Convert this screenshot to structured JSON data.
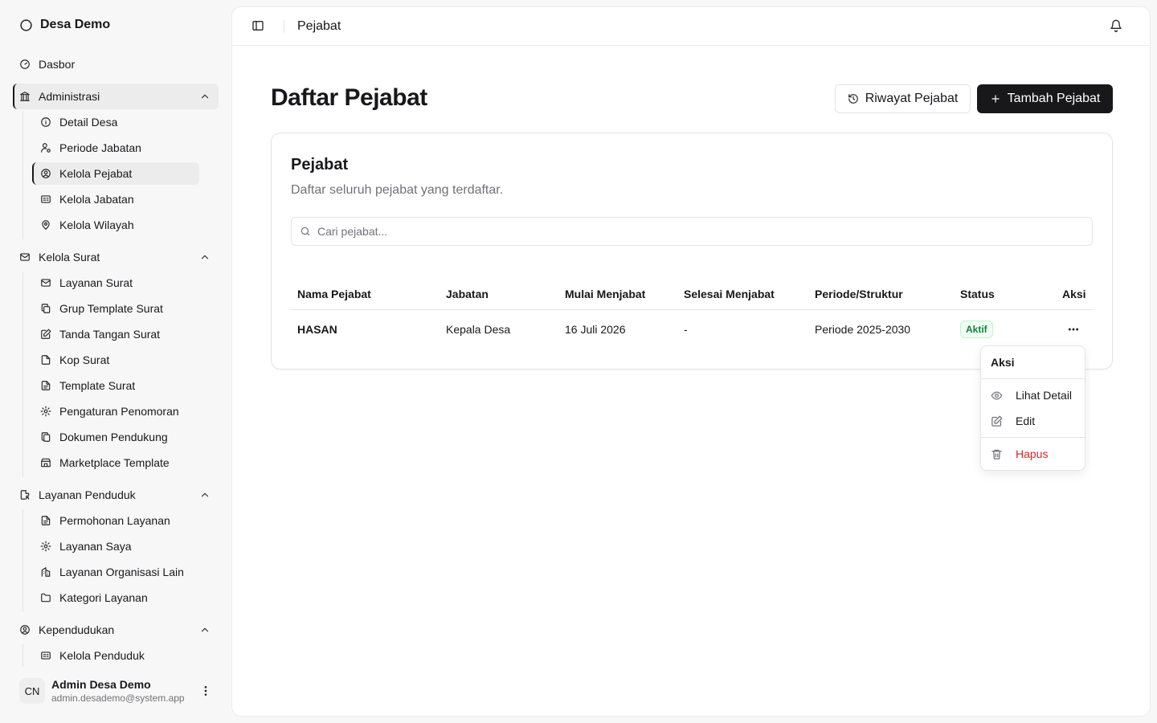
{
  "sidebar": {
    "brand": "Desa Demo",
    "dashboard": "Dasbor",
    "groups": [
      {
        "label": "Administrasi",
        "items": [
          "Detail Desa",
          "Periode Jabatan",
          "Kelola Pejabat",
          "Kelola Jabatan",
          "Kelola Wilayah"
        ]
      },
      {
        "label": "Kelola Surat",
        "items": [
          "Layanan Surat",
          "Grup Template Surat",
          "Tanda Tangan Surat",
          "Kop Surat",
          "Template Surat",
          "Pengaturan Penomoran",
          "Dokumen Pendukung",
          "Marketplace Template"
        ]
      },
      {
        "label": "Layanan Penduduk",
        "items": [
          "Permohonan Layanan",
          "Layanan Saya",
          "Layanan Organisasi Lain",
          "Kategori Layanan"
        ]
      },
      {
        "label": "Kependudukan",
        "items": [
          "Kelola Penduduk"
        ]
      }
    ],
    "user": {
      "initials": "CN",
      "name": "Admin Desa Demo",
      "email": "admin.desademo@system.app"
    }
  },
  "topbar": {
    "title": "Pejabat"
  },
  "page": {
    "title": "Daftar Pejabat",
    "history_button": "Riwayat Pejabat",
    "add_button": "Tambah Pejabat"
  },
  "card": {
    "title": "Pejabat",
    "description": "Daftar seluruh pejabat yang terdaftar.",
    "search_placeholder": "Cari pejabat..."
  },
  "table": {
    "headers": [
      "Nama Pejabat",
      "Jabatan",
      "Mulai Menjabat",
      "Selesai Menjabat",
      "Periode/Struktur",
      "Status",
      "Aksi"
    ],
    "rows": [
      {
        "nama": "HASAN",
        "jabatan": "Kepala Desa",
        "mulai": "16 Juli 2026",
        "selesai": "-",
        "periode": "Periode 2025-2030",
        "status": "Aktif"
      }
    ]
  },
  "dropdown": {
    "label": "Aksi",
    "view": "Lihat Detail",
    "edit": "Edit",
    "delete": "Hapus"
  },
  "colors": {
    "primary": "#18181b",
    "danger": "#dc2626",
    "success": "#15803d"
  }
}
